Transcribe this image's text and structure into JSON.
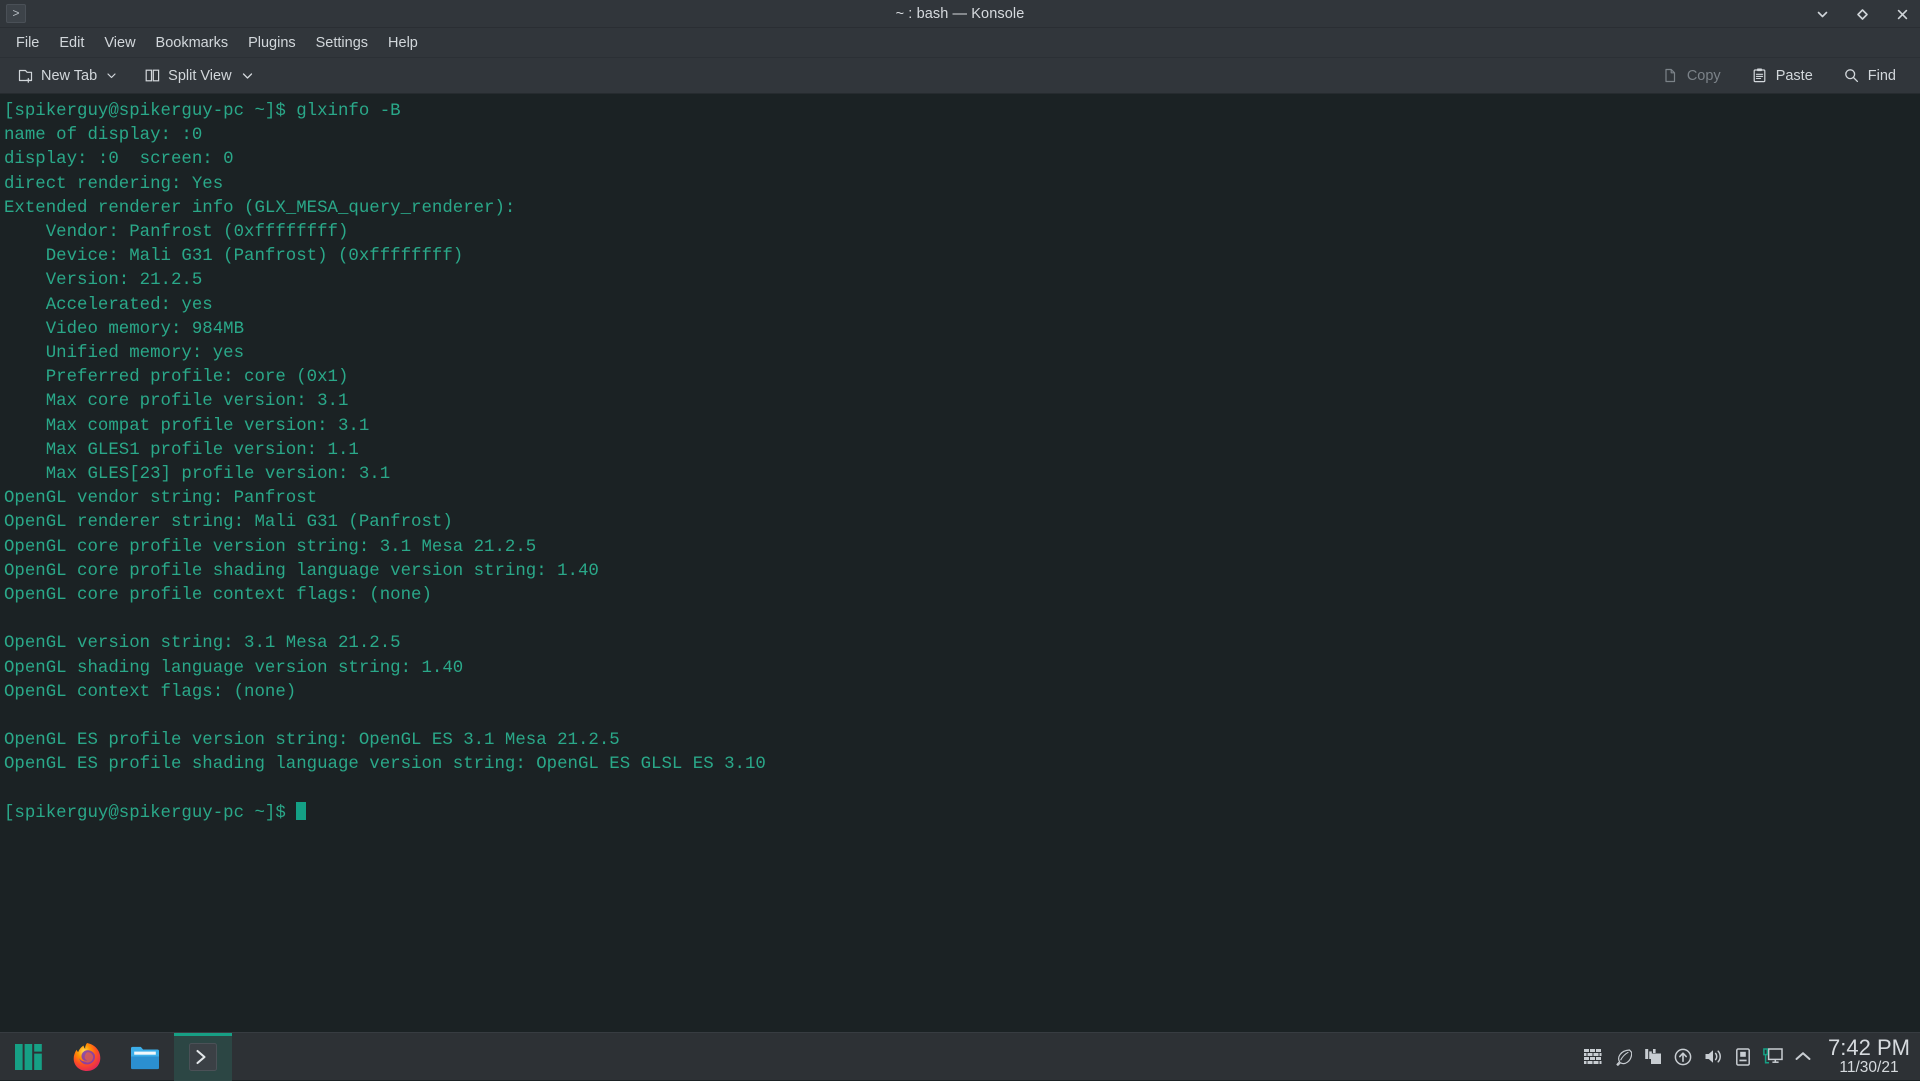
{
  "window": {
    "title": "~ : bash — Konsole",
    "app_icon": "terminal-prompt-icon",
    "controls": [
      {
        "name": "minimize",
        "glyph": "chevron-down-icon"
      },
      {
        "name": "maximize",
        "glyph": "diamond-icon"
      },
      {
        "name": "close",
        "glyph": "close-x-icon"
      }
    ]
  },
  "menubar": {
    "items": [
      {
        "label": "File"
      },
      {
        "label": "Edit"
      },
      {
        "label": "View"
      },
      {
        "label": "Bookmarks"
      },
      {
        "label": "Plugins"
      },
      {
        "label": "Settings"
      },
      {
        "label": "Help"
      }
    ]
  },
  "toolbar": {
    "new_tab_label": "New Tab",
    "split_view_label": "Split View",
    "copy_label": "Copy",
    "paste_label": "Paste",
    "find_label": "Find",
    "copy_disabled": true
  },
  "terminal": {
    "prompt": "[spikerguy@spikerguy-pc ~]$ ",
    "command": "glxinfo -B",
    "foreground_color": "#2aa889",
    "background_color": "#1b2224",
    "cursor_color": "#14a085",
    "output": "[spikerguy@spikerguy-pc ~]$ glxinfo -B\nname of display: :0\ndisplay: :0  screen: 0\ndirect rendering: Yes\nExtended renderer info (GLX_MESA_query_renderer):\n    Vendor: Panfrost (0xffffffff)\n    Device: Mali G31 (Panfrost) (0xffffffff)\n    Version: 21.2.5\n    Accelerated: yes\n    Video memory: 984MB\n    Unified memory: yes\n    Preferred profile: core (0x1)\n    Max core profile version: 3.1\n    Max compat profile version: 3.1\n    Max GLES1 profile version: 1.1\n    Max GLES[23] profile version: 3.1\nOpenGL vendor string: Panfrost\nOpenGL renderer string: Mali G31 (Panfrost)\nOpenGL core profile version string: 3.1 Mesa 21.2.5\nOpenGL core profile shading language version string: 1.40\nOpenGL core profile context flags: (none)\n\nOpenGL version string: 3.1 Mesa 21.2.5\nOpenGL shading language version string: 1.40\nOpenGL context flags: (none)\n\nOpenGL ES profile version string: OpenGL ES 3.1 Mesa 21.2.5\nOpenGL ES profile shading language version string: OpenGL ES GLSL ES 3.10\n\n[spikerguy@spikerguy-pc ~]$ "
  },
  "taskbar": {
    "launchers": [
      {
        "name": "manjaro-menu-icon",
        "active": false
      },
      {
        "name": "firefox-icon",
        "active": false
      },
      {
        "name": "file-manager-icon",
        "active": false
      },
      {
        "name": "konsole-icon",
        "active": true
      }
    ],
    "tray": [
      {
        "name": "firewall-icon"
      },
      {
        "name": "feather-icon"
      },
      {
        "name": "klipper-clipboard-icon"
      },
      {
        "name": "updates-icon"
      },
      {
        "name": "volume-icon"
      },
      {
        "name": "usb-device-icon"
      },
      {
        "name": "display-icon"
      },
      {
        "name": "show-hidden-icons-icon"
      }
    ],
    "clock": {
      "time": "7:42 PM",
      "date": "11/30/21"
    }
  }
}
